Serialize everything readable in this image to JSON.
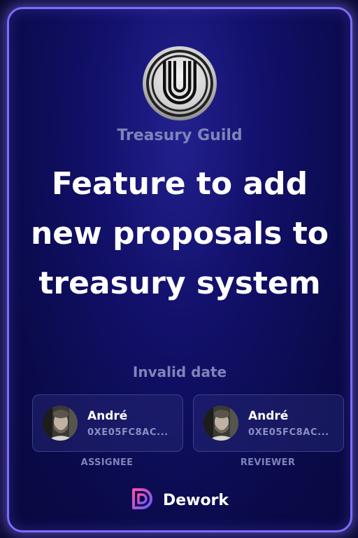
{
  "guild": {
    "name": "Treasury Guild",
    "logo_icon": "guild-u-logo-icon"
  },
  "task": {
    "title": "Feature to add new proposals to treasury system",
    "date": "Invalid date"
  },
  "assignee": {
    "name": "André",
    "address": "0XE05FC8AC...",
    "role": "ASSIGNEE",
    "avatar_icon": "avatar-photo"
  },
  "reviewer": {
    "name": "André",
    "address": "0XE05FC8AC...",
    "role": "REVIEWER",
    "avatar_icon": "avatar-photo"
  },
  "brand": {
    "name": "Dework",
    "logo_icon": "dework-logo-icon"
  },
  "colors": {
    "card_border": "#7d6bff",
    "card_background": "#12106a",
    "muted_text": "#7f83b9",
    "brand_gradient_start": "#ff4fa8",
    "brand_gradient_end": "#6a5cff"
  }
}
